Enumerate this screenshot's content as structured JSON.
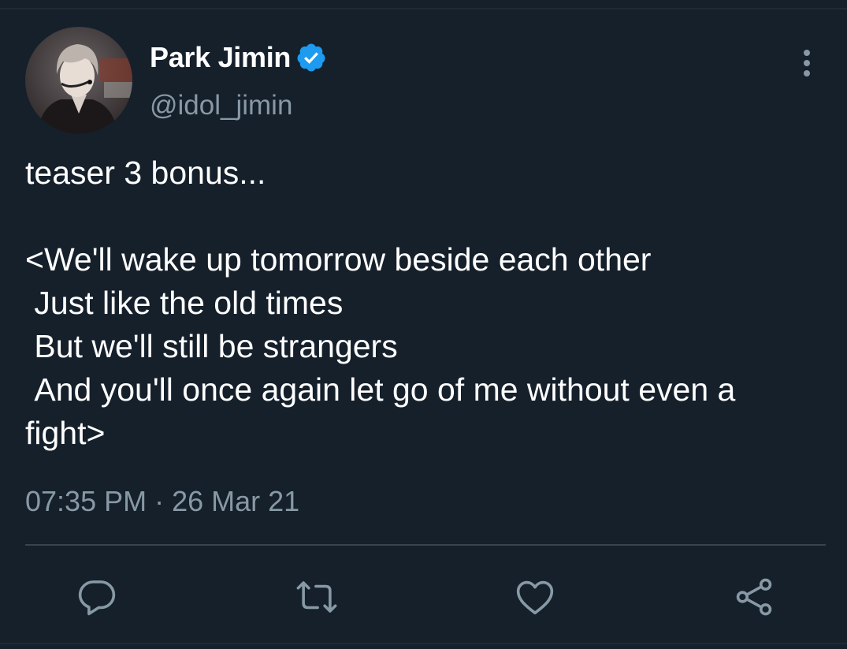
{
  "tweet": {
    "display_name": "Park Jimin",
    "handle": "@idol_jimin",
    "verified": true,
    "text": "teaser 3 bonus...\n\n<We'll wake up tomorrow beside each other\n Just like the old times\n But we'll still be strangers\n And you'll once again let go of me without even a fight>",
    "timestamp": "07:35 PM · 26 Mar 21"
  },
  "icons": {
    "avatar": "profile-photo",
    "verified": "verified-badge-icon",
    "more": "more-options-icon",
    "reply": "reply-icon",
    "retweet": "retweet-icon",
    "like": "like-icon",
    "share": "share-icon"
  },
  "colors": {
    "background": "#15202b",
    "text_primary": "#ffffff",
    "text_secondary": "#8899a6",
    "accent": "#1d9bf0",
    "divider": "#38444d"
  }
}
